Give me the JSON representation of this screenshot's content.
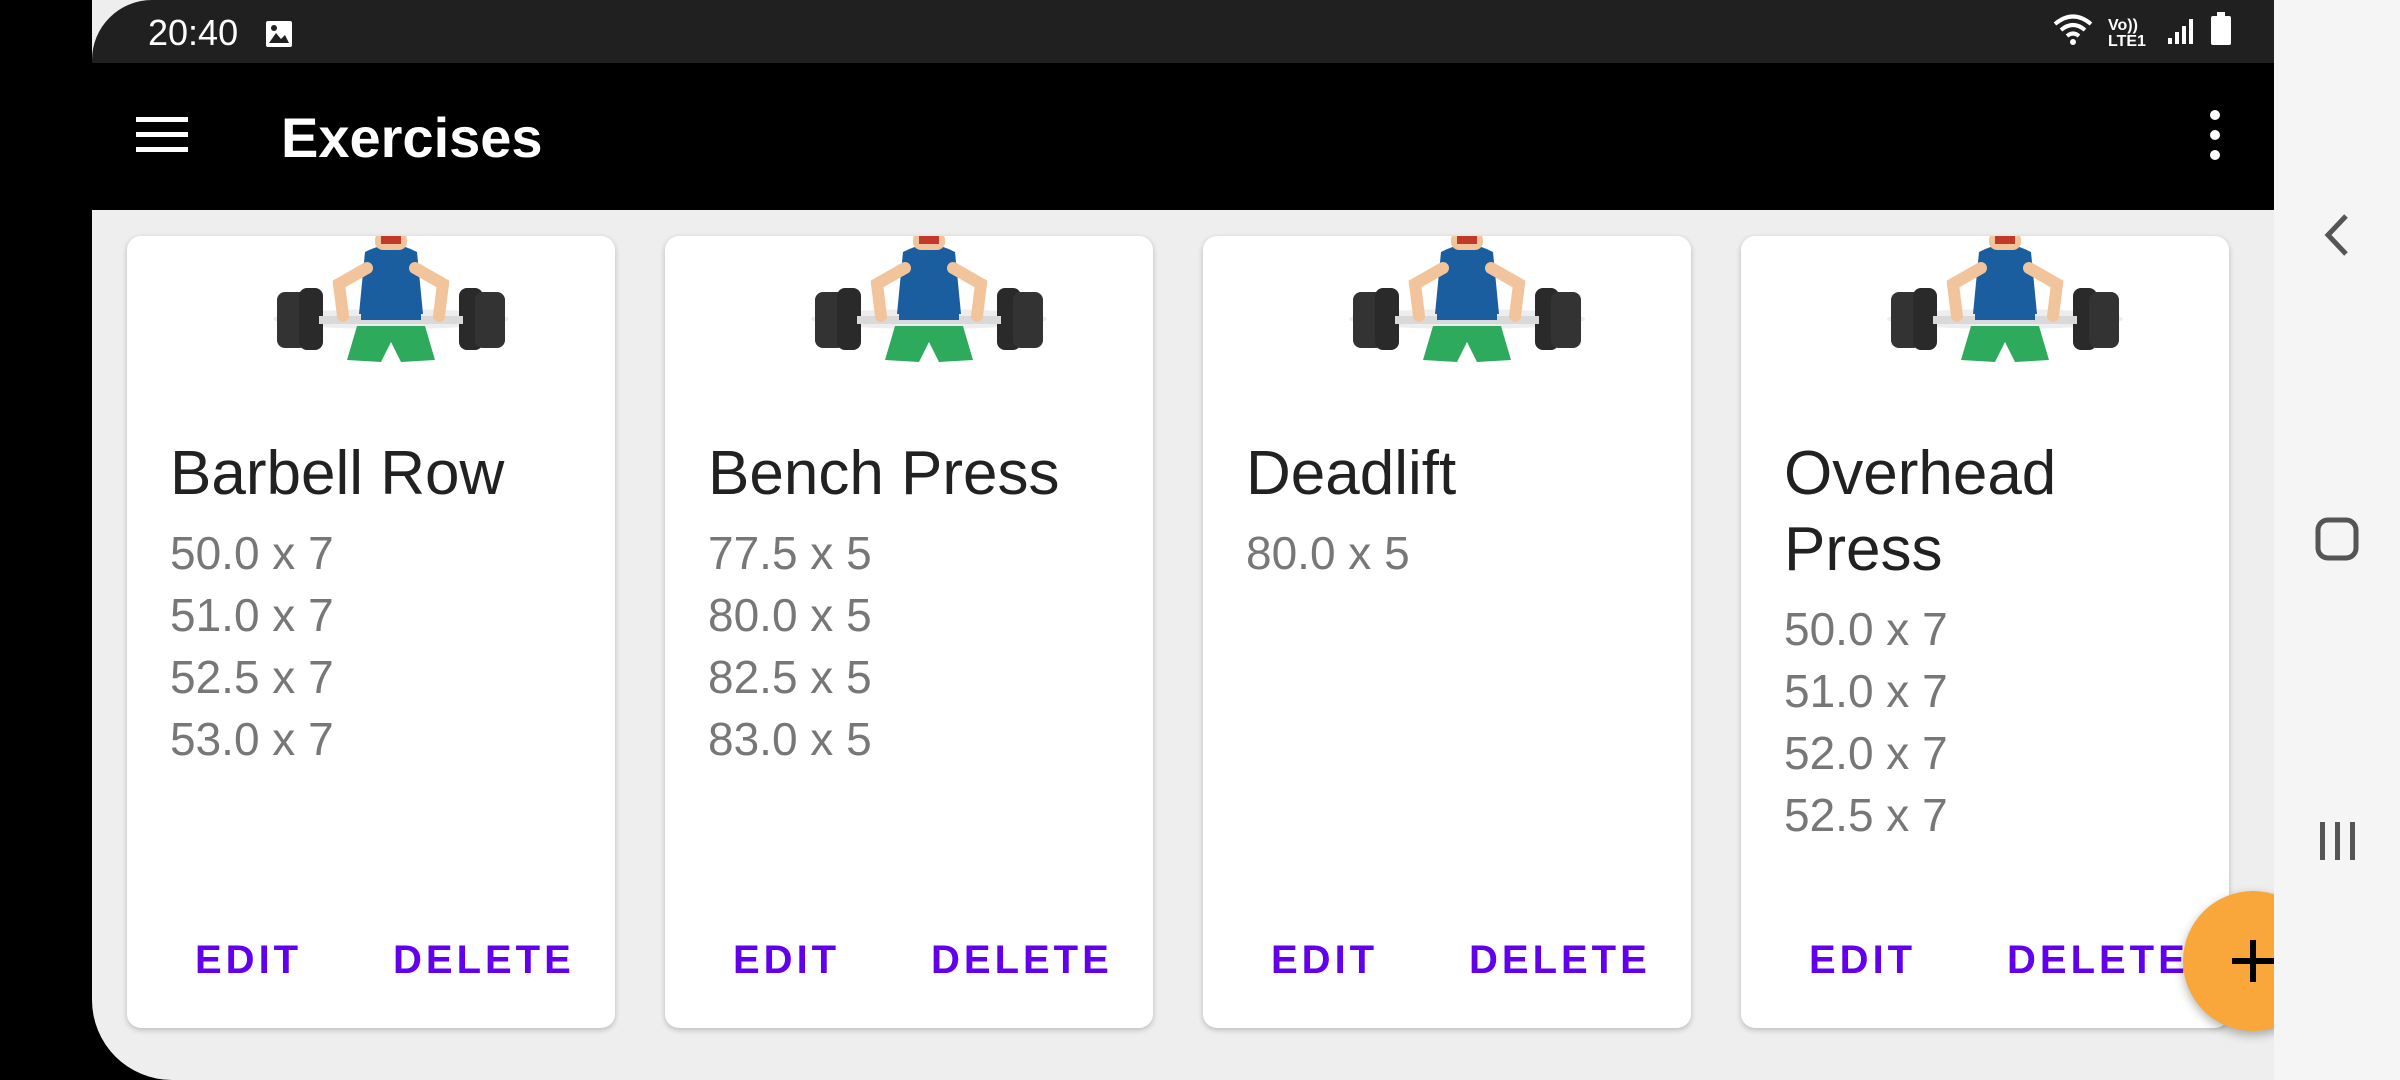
{
  "status_bar": {
    "time": "20:40",
    "network_label": "Vo)) LTE1"
  },
  "app_bar": {
    "title": "Exercises"
  },
  "exercises": [
    {
      "name": "Barbell Row",
      "sets": [
        "50.0 x 7",
        "51.0 x 7",
        "52.5 x 7",
        "53.0 x 7"
      ]
    },
    {
      "name": "Bench Press",
      "sets": [
        "77.5 x 5",
        "80.0 x 5",
        "82.5 x 5",
        "83.0 x 5"
      ]
    },
    {
      "name": "Deadlift",
      "sets": [
        "80.0 x 5"
      ]
    },
    {
      "name": "Overhead Press",
      "sets": [
        "50.0 x 7",
        "51.0 x 7",
        "52.0 x 7",
        "52.5 x 7"
      ]
    }
  ],
  "card_actions": {
    "edit_label": "EDIT",
    "delete_label": "DELETE"
  },
  "fab": {
    "icon": "plus-icon",
    "color": "#f9a63a"
  },
  "colors": {
    "accent": "#6200ee",
    "app_bar": "#000000",
    "background": "#eeeeee"
  },
  "nav_bar": {
    "icons": [
      "back-icon",
      "home-icon",
      "recents-icon"
    ]
  }
}
